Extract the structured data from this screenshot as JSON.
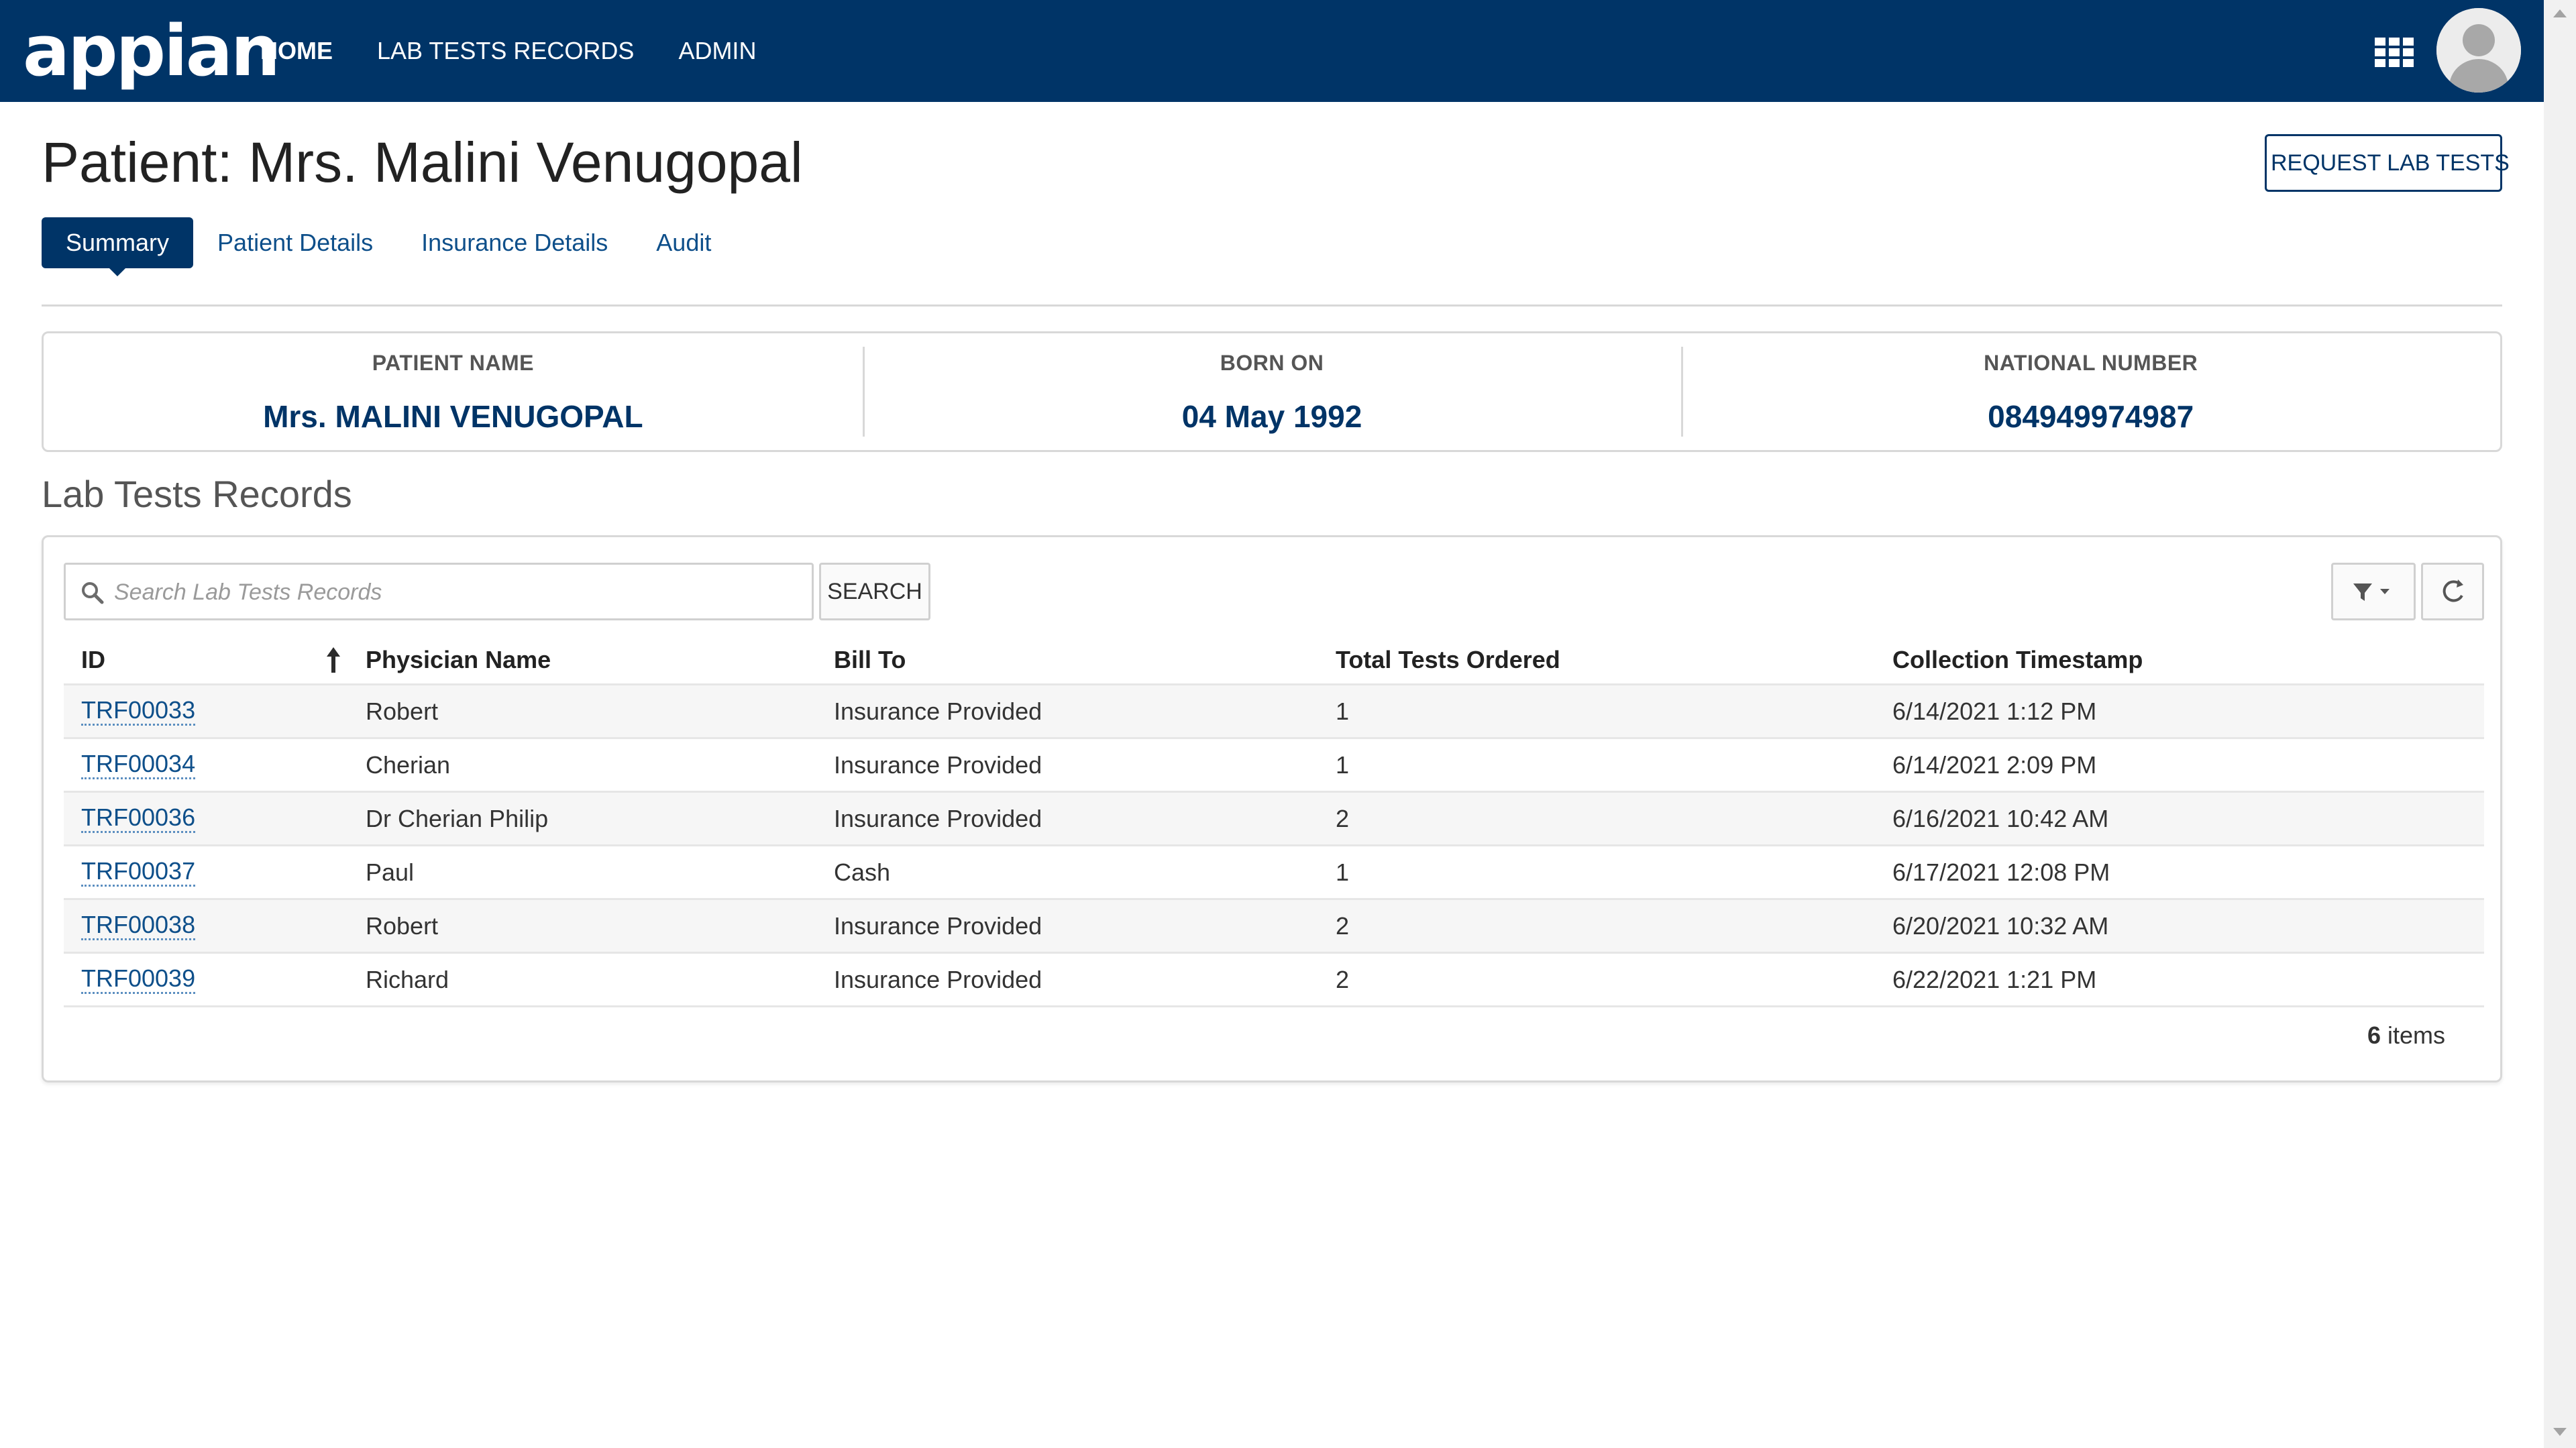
{
  "topbar": {
    "logo": "appian",
    "nav": [
      {
        "label": "HOME",
        "active": true
      },
      {
        "label": "LAB TESTS RECORDS",
        "active": false
      },
      {
        "label": "ADMIN",
        "active": false
      }
    ],
    "icons": {
      "apps": "apps-grid-icon",
      "avatar": "user-avatar-icon"
    },
    "colors": {
      "bar": "#003467"
    }
  },
  "header": {
    "title": "Patient: Mrs. Malini Venugopal",
    "request_button": "REQUEST LAB TESTS"
  },
  "tabs": [
    {
      "label": "Summary",
      "active": true
    },
    {
      "label": "Patient Details",
      "active": false
    },
    {
      "label": "Insurance Details",
      "active": false
    },
    {
      "label": "Audit",
      "active": false
    }
  ],
  "summary": {
    "patient_name": {
      "label": "PATIENT NAME",
      "value": "Mrs. MALINI VENUGOPAL"
    },
    "born_on": {
      "label": "BORN ON",
      "value": "04 May 1992"
    },
    "national_number": {
      "label": "NATIONAL NUMBER",
      "value": "084949974987"
    }
  },
  "records": {
    "section_title": "Lab Tests Records",
    "search_placeholder": "Search Lab Tests Records",
    "search_value": "",
    "search_button": "SEARCH",
    "columns": [
      "ID",
      "Physician Name",
      "Bill To",
      "Total Tests Ordered",
      "Collection Timestamp"
    ],
    "sort": {
      "column": "ID",
      "direction": "ascending"
    },
    "rows": [
      {
        "id": "TRF00033",
        "physician": "Robert",
        "bill_to": "Insurance Provided",
        "total": "1",
        "timestamp": "6/14/2021 1:12 PM"
      },
      {
        "id": "TRF00034",
        "physician": "Cherian",
        "bill_to": "Insurance Provided",
        "total": "1",
        "timestamp": "6/14/2021 2:09 PM"
      },
      {
        "id": "TRF00036",
        "physician": "Dr Cherian Philip",
        "bill_to": "Insurance Provided",
        "total": "2",
        "timestamp": "6/16/2021 10:42 AM"
      },
      {
        "id": "TRF00037",
        "physician": "Paul",
        "bill_to": "Cash",
        "total": "1",
        "timestamp": "6/17/2021 12:08 PM"
      },
      {
        "id": "TRF00038",
        "physician": "Robert",
        "bill_to": "Insurance Provided",
        "total": "2",
        "timestamp": "6/20/2021 10:32 AM"
      },
      {
        "id": "TRF00039",
        "physician": "Richard",
        "bill_to": "Insurance Provided",
        "total": "2",
        "timestamp": "6/22/2021 1:21 PM"
      }
    ],
    "item_count": "6",
    "item_label": "items"
  }
}
